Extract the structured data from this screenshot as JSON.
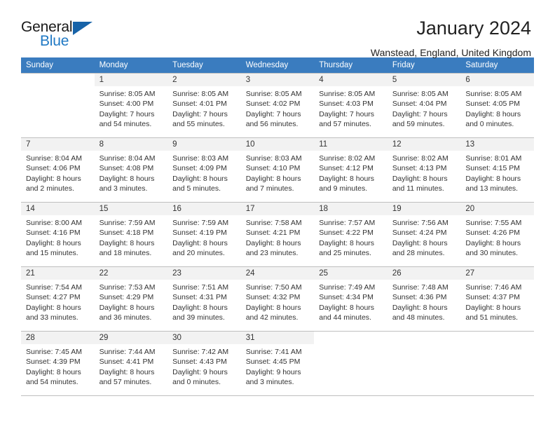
{
  "brand": {
    "name_top": "General",
    "name_bottom": "Blue",
    "triangle_color": "#1763a8",
    "blue_color": "#2079c4"
  },
  "header": {
    "title": "January 2024",
    "subtitle": "Wanstead, England, United Kingdom"
  },
  "theme": {
    "header_row_bg": "#3a7cbf",
    "header_row_text": "#ffffff",
    "daynum_bg": "#f2f2f2",
    "grid_line": "#bfbfbf",
    "body_text": "#333333"
  },
  "weekday_headers": [
    "Sunday",
    "Monday",
    "Tuesday",
    "Wednesday",
    "Thursday",
    "Friday",
    "Saturday"
  ],
  "weeks": [
    [
      {
        "day": "",
        "sunrise": "",
        "sunset": "",
        "daylight1": "",
        "daylight2": ""
      },
      {
        "day": "1",
        "sunrise": "Sunrise: 8:05 AM",
        "sunset": "Sunset: 4:00 PM",
        "daylight1": "Daylight: 7 hours",
        "daylight2": "and 54 minutes."
      },
      {
        "day": "2",
        "sunrise": "Sunrise: 8:05 AM",
        "sunset": "Sunset: 4:01 PM",
        "daylight1": "Daylight: 7 hours",
        "daylight2": "and 55 minutes."
      },
      {
        "day": "3",
        "sunrise": "Sunrise: 8:05 AM",
        "sunset": "Sunset: 4:02 PM",
        "daylight1": "Daylight: 7 hours",
        "daylight2": "and 56 minutes."
      },
      {
        "day": "4",
        "sunrise": "Sunrise: 8:05 AM",
        "sunset": "Sunset: 4:03 PM",
        "daylight1": "Daylight: 7 hours",
        "daylight2": "and 57 minutes."
      },
      {
        "day": "5",
        "sunrise": "Sunrise: 8:05 AM",
        "sunset": "Sunset: 4:04 PM",
        "daylight1": "Daylight: 7 hours",
        "daylight2": "and 59 minutes."
      },
      {
        "day": "6",
        "sunrise": "Sunrise: 8:05 AM",
        "sunset": "Sunset: 4:05 PM",
        "daylight1": "Daylight: 8 hours",
        "daylight2": "and 0 minutes."
      }
    ],
    [
      {
        "day": "7",
        "sunrise": "Sunrise: 8:04 AM",
        "sunset": "Sunset: 4:06 PM",
        "daylight1": "Daylight: 8 hours",
        "daylight2": "and 2 minutes."
      },
      {
        "day": "8",
        "sunrise": "Sunrise: 8:04 AM",
        "sunset": "Sunset: 4:08 PM",
        "daylight1": "Daylight: 8 hours",
        "daylight2": "and 3 minutes."
      },
      {
        "day": "9",
        "sunrise": "Sunrise: 8:03 AM",
        "sunset": "Sunset: 4:09 PM",
        "daylight1": "Daylight: 8 hours",
        "daylight2": "and 5 minutes."
      },
      {
        "day": "10",
        "sunrise": "Sunrise: 8:03 AM",
        "sunset": "Sunset: 4:10 PM",
        "daylight1": "Daylight: 8 hours",
        "daylight2": "and 7 minutes."
      },
      {
        "day": "11",
        "sunrise": "Sunrise: 8:02 AM",
        "sunset": "Sunset: 4:12 PM",
        "daylight1": "Daylight: 8 hours",
        "daylight2": "and 9 minutes."
      },
      {
        "day": "12",
        "sunrise": "Sunrise: 8:02 AM",
        "sunset": "Sunset: 4:13 PM",
        "daylight1": "Daylight: 8 hours",
        "daylight2": "and 11 minutes."
      },
      {
        "day": "13",
        "sunrise": "Sunrise: 8:01 AM",
        "sunset": "Sunset: 4:15 PM",
        "daylight1": "Daylight: 8 hours",
        "daylight2": "and 13 minutes."
      }
    ],
    [
      {
        "day": "14",
        "sunrise": "Sunrise: 8:00 AM",
        "sunset": "Sunset: 4:16 PM",
        "daylight1": "Daylight: 8 hours",
        "daylight2": "and 15 minutes."
      },
      {
        "day": "15",
        "sunrise": "Sunrise: 7:59 AM",
        "sunset": "Sunset: 4:18 PM",
        "daylight1": "Daylight: 8 hours",
        "daylight2": "and 18 minutes."
      },
      {
        "day": "16",
        "sunrise": "Sunrise: 7:59 AM",
        "sunset": "Sunset: 4:19 PM",
        "daylight1": "Daylight: 8 hours",
        "daylight2": "and 20 minutes."
      },
      {
        "day": "17",
        "sunrise": "Sunrise: 7:58 AM",
        "sunset": "Sunset: 4:21 PM",
        "daylight1": "Daylight: 8 hours",
        "daylight2": "and 23 minutes."
      },
      {
        "day": "18",
        "sunrise": "Sunrise: 7:57 AM",
        "sunset": "Sunset: 4:22 PM",
        "daylight1": "Daylight: 8 hours",
        "daylight2": "and 25 minutes."
      },
      {
        "day": "19",
        "sunrise": "Sunrise: 7:56 AM",
        "sunset": "Sunset: 4:24 PM",
        "daylight1": "Daylight: 8 hours",
        "daylight2": "and 28 minutes."
      },
      {
        "day": "20",
        "sunrise": "Sunrise: 7:55 AM",
        "sunset": "Sunset: 4:26 PM",
        "daylight1": "Daylight: 8 hours",
        "daylight2": "and 30 minutes."
      }
    ],
    [
      {
        "day": "21",
        "sunrise": "Sunrise: 7:54 AM",
        "sunset": "Sunset: 4:27 PM",
        "daylight1": "Daylight: 8 hours",
        "daylight2": "and 33 minutes."
      },
      {
        "day": "22",
        "sunrise": "Sunrise: 7:53 AM",
        "sunset": "Sunset: 4:29 PM",
        "daylight1": "Daylight: 8 hours",
        "daylight2": "and 36 minutes."
      },
      {
        "day": "23",
        "sunrise": "Sunrise: 7:51 AM",
        "sunset": "Sunset: 4:31 PM",
        "daylight1": "Daylight: 8 hours",
        "daylight2": "and 39 minutes."
      },
      {
        "day": "24",
        "sunrise": "Sunrise: 7:50 AM",
        "sunset": "Sunset: 4:32 PM",
        "daylight1": "Daylight: 8 hours",
        "daylight2": "and 42 minutes."
      },
      {
        "day": "25",
        "sunrise": "Sunrise: 7:49 AM",
        "sunset": "Sunset: 4:34 PM",
        "daylight1": "Daylight: 8 hours",
        "daylight2": "and 44 minutes."
      },
      {
        "day": "26",
        "sunrise": "Sunrise: 7:48 AM",
        "sunset": "Sunset: 4:36 PM",
        "daylight1": "Daylight: 8 hours",
        "daylight2": "and 48 minutes."
      },
      {
        "day": "27",
        "sunrise": "Sunrise: 7:46 AM",
        "sunset": "Sunset: 4:37 PM",
        "daylight1": "Daylight: 8 hours",
        "daylight2": "and 51 minutes."
      }
    ],
    [
      {
        "day": "28",
        "sunrise": "Sunrise: 7:45 AM",
        "sunset": "Sunset: 4:39 PM",
        "daylight1": "Daylight: 8 hours",
        "daylight2": "and 54 minutes."
      },
      {
        "day": "29",
        "sunrise": "Sunrise: 7:44 AM",
        "sunset": "Sunset: 4:41 PM",
        "daylight1": "Daylight: 8 hours",
        "daylight2": "and 57 minutes."
      },
      {
        "day": "30",
        "sunrise": "Sunrise: 7:42 AM",
        "sunset": "Sunset: 4:43 PM",
        "daylight1": "Daylight: 9 hours",
        "daylight2": "and 0 minutes."
      },
      {
        "day": "31",
        "sunrise": "Sunrise: 7:41 AM",
        "sunset": "Sunset: 4:45 PM",
        "daylight1": "Daylight: 9 hours",
        "daylight2": "and 3 minutes."
      },
      {
        "day": "",
        "sunrise": "",
        "sunset": "",
        "daylight1": "",
        "daylight2": ""
      },
      {
        "day": "",
        "sunrise": "",
        "sunset": "",
        "daylight1": "",
        "daylight2": ""
      },
      {
        "day": "",
        "sunrise": "",
        "sunset": "",
        "daylight1": "",
        "daylight2": ""
      }
    ]
  ]
}
